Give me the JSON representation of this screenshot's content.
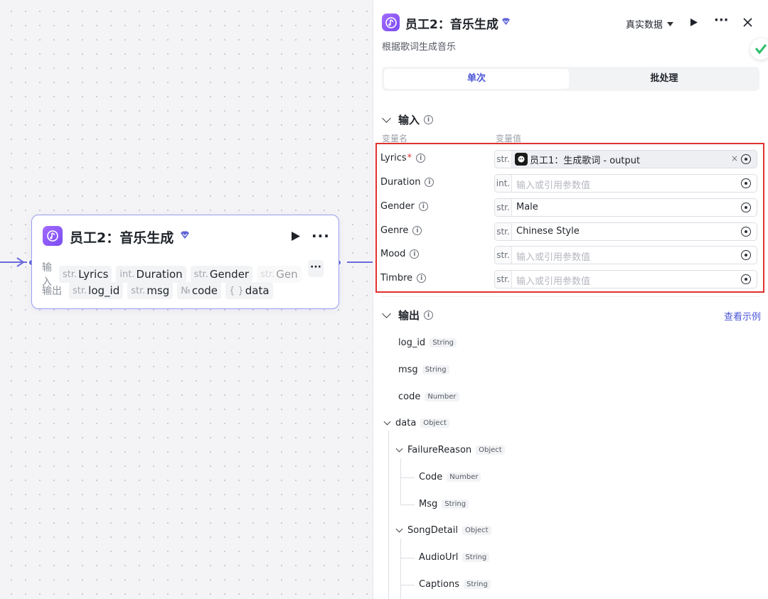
{
  "node": {
    "title": "员工2：音乐生成",
    "input_label": "输入",
    "output_label": "输出",
    "inputs": [
      {
        "type": "str.",
        "name": "Lyrics"
      },
      {
        "type": "int.",
        "name": "Duration"
      },
      {
        "type": "str.",
        "name": "Gender"
      },
      {
        "type": "str.",
        "name": "Gen"
      }
    ],
    "outputs": [
      {
        "type": "str.",
        "name": "log_id"
      },
      {
        "type": "str.",
        "name": "msg"
      },
      {
        "type": "№",
        "name": "code"
      },
      {
        "type": "{ }",
        "name": "data"
      }
    ]
  },
  "panel": {
    "title": "员工2：音乐生成",
    "description": "根据歌词生成音乐",
    "data_mode": "真实数据",
    "tabs": {
      "single": "单次",
      "batch": "批处理"
    },
    "input_section": "输入",
    "col_name": "变量名",
    "col_value": "变量值",
    "inputs": [
      {
        "name": "Lyrics",
        "required": "*",
        "type": "str.",
        "ref": "员工1：生成歌词 - output",
        "placeholder": ""
      },
      {
        "name": "Duration",
        "type": "int.",
        "value": "",
        "placeholder": "输入或引用参数值"
      },
      {
        "name": "Gender",
        "type": "str.",
        "value": "Male",
        "placeholder": ""
      },
      {
        "name": "Genre",
        "type": "str.",
        "value": "Chinese Style",
        "placeholder": ""
      },
      {
        "name": "Mood",
        "type": "str.",
        "value": "",
        "placeholder": "输入或引用参数值"
      },
      {
        "name": "Timbre",
        "type": "str.",
        "value": "",
        "placeholder": "输入或引用参数值"
      }
    ],
    "output_section": "输出",
    "view_example": "查看示例",
    "outputs": [
      {
        "name": "log_id",
        "type": "String"
      },
      {
        "name": "msg",
        "type": "String"
      },
      {
        "name": "code",
        "type": "Number"
      },
      {
        "name": "data",
        "type": "Object"
      },
      {
        "name": "FailureReason",
        "type": "Object"
      },
      {
        "name": "Code",
        "type": "Number"
      },
      {
        "name": "Msg",
        "type": "String"
      },
      {
        "name": "SongDetail",
        "type": "Object"
      },
      {
        "name": "AudioUrl",
        "type": "String"
      },
      {
        "name": "Captions",
        "type": "String"
      }
    ]
  },
  "colors": {
    "accent": "#5b5fd6",
    "highlight": "#e0322f",
    "link": "#4a55d8"
  }
}
